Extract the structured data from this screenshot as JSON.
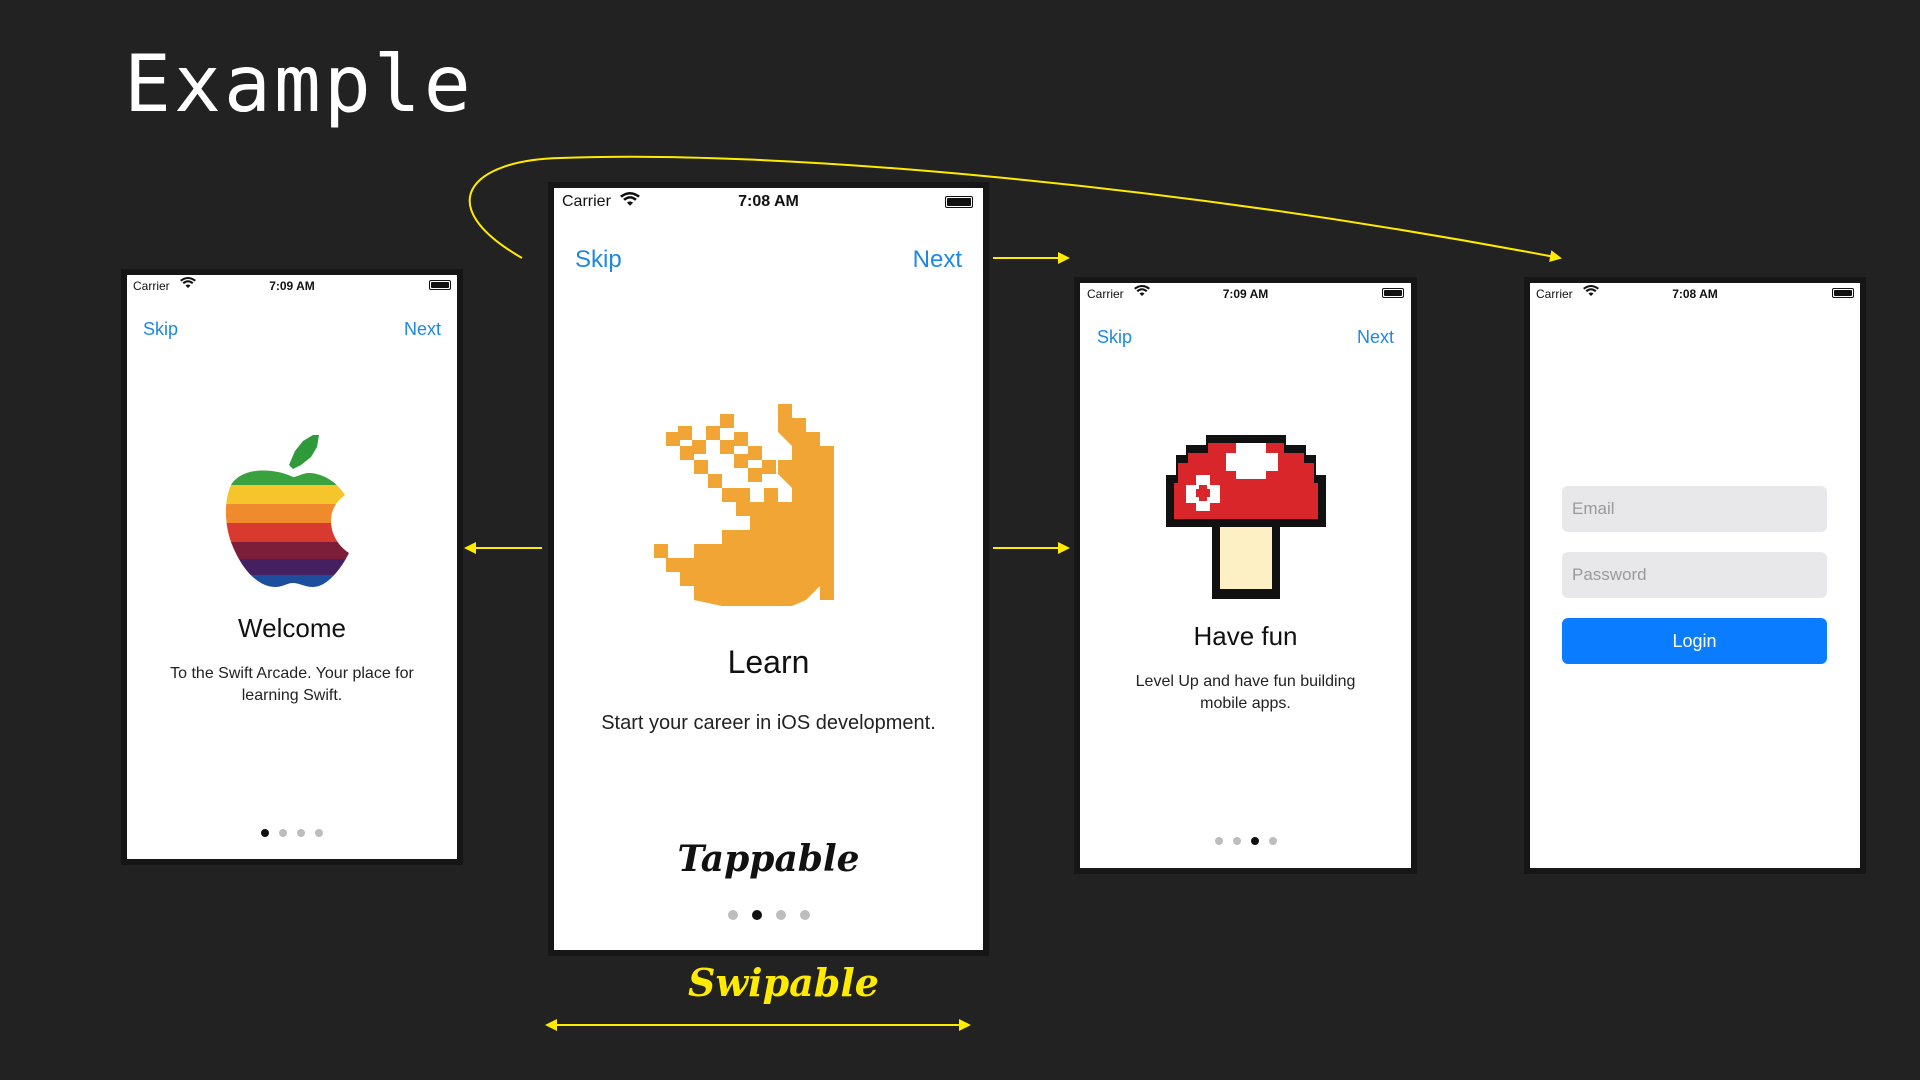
{
  "slide": {
    "title": "Example"
  },
  "colors": {
    "background": "#232222",
    "link": "#1e88e5",
    "arrow": "#ffeb00",
    "button": "#0a7cff"
  },
  "phones": {
    "welcome": {
      "status": {
        "carrier": "Carrier",
        "time": "7:09 AM"
      },
      "skip": "Skip",
      "next": "Next",
      "icon": "rainbow-apple-icon",
      "heading": "Welcome",
      "body": "To the Swift Arcade. Your place for learning Swift.",
      "page_count": 4,
      "current_page": 1
    },
    "learn": {
      "status": {
        "carrier": "Carrier",
        "time": "7:08 AM"
      },
      "skip": "Skip",
      "next": "Next",
      "icon": "swift-bird-icon",
      "heading": "Learn",
      "body": "Start your career in iOS development.",
      "annotation": "Tappable",
      "page_count": 4,
      "current_page": 2
    },
    "fun": {
      "status": {
        "carrier": "Carrier",
        "time": "7:09 AM"
      },
      "skip": "Skip",
      "next": "Next",
      "icon": "mushroom-icon",
      "heading": "Have fun",
      "body": "Level Up and have fun building mobile apps.",
      "page_count": 4,
      "current_page": 3
    },
    "login": {
      "status": {
        "carrier": "Carrier",
        "time": "7:08 AM"
      },
      "email_placeholder": "Email",
      "password_placeholder": "Password",
      "login_label": "Login"
    }
  },
  "annotations": {
    "swipable": "Swipable"
  }
}
